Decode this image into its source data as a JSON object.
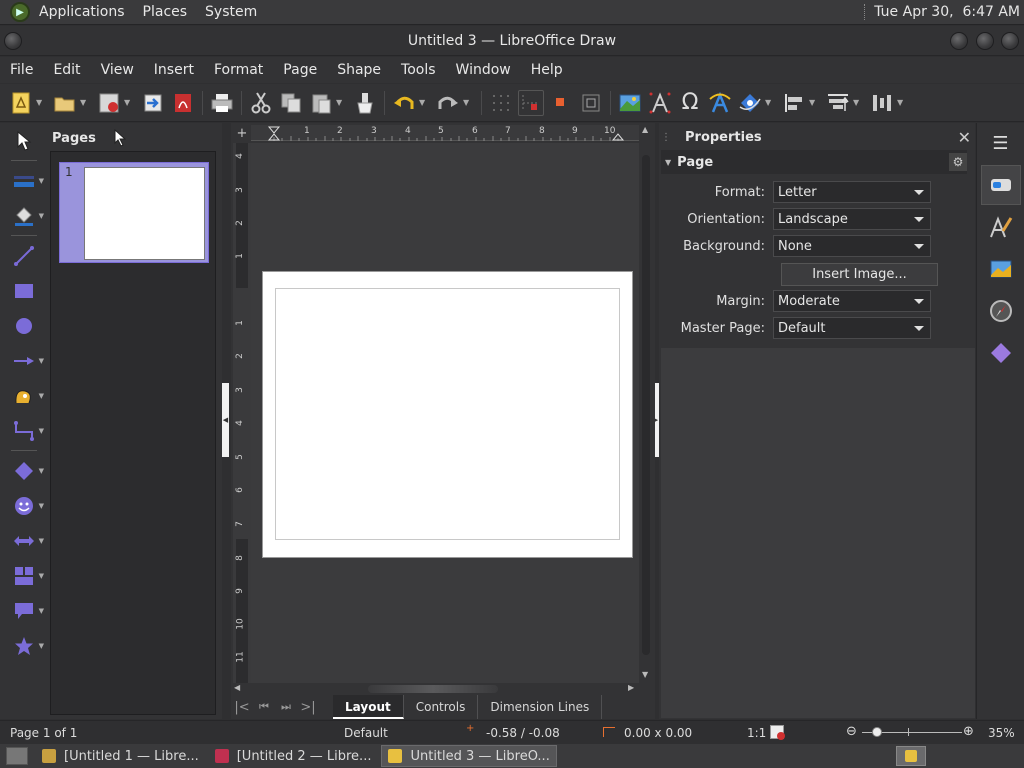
{
  "top_panel": {
    "menus": [
      "Applications",
      "Places",
      "System"
    ],
    "clock": "Tue Apr 30,  6:47 AM"
  },
  "window": {
    "title": "Untitled 3 — LibreOffice Draw"
  },
  "menubar": [
    "File",
    "Edit",
    "View",
    "Insert",
    "Format",
    "Page",
    "Shape",
    "Tools",
    "Window",
    "Help"
  ],
  "toolbar": {
    "icons": [
      "new-icon",
      "open-icon",
      "save-icon",
      "export-icon",
      "export-pdf-icon",
      "print-icon",
      "cut-icon",
      "copy-icon",
      "paste-icon",
      "clone-formatting-icon",
      "undo-icon",
      "redo-icon",
      "grid-icon",
      "helplines-icon",
      "zoom-icon",
      "image-icon",
      "fontwork-text-icon",
      "special-character-icon",
      "fontwork-icon",
      "transformations-icon",
      "align-icon",
      "arrange-icon",
      "distribute-icon"
    ]
  },
  "pages_panel": {
    "title": "Pages",
    "thumb_number": "1"
  },
  "ruler": {
    "h_ticks": [
      "1",
      "2",
      "3",
      "4",
      "5",
      "6",
      "7",
      "8",
      "9",
      "10"
    ],
    "v_ticks": [
      "4",
      "3",
      "2",
      "1",
      "1",
      "2",
      "3",
      "4",
      "5",
      "6",
      "7",
      "8",
      "9",
      "10",
      "11"
    ]
  },
  "tabs": [
    "Layout",
    "Controls",
    "Dimension Lines"
  ],
  "properties": {
    "title": "Properties",
    "section": "Page",
    "rows": [
      {
        "label": "Format:",
        "value": "Letter"
      },
      {
        "label": "Orientation:",
        "value": "Landscape"
      },
      {
        "label": "Background:",
        "value": "None"
      },
      {
        "label": "Margin:",
        "value": "Moderate"
      },
      {
        "label": "Master Page:",
        "value": "Default"
      }
    ],
    "insert_image": "Insert Image..."
  },
  "statusbar": {
    "page": "Page 1 of 1",
    "master": "Default",
    "position": "-0.58 / -0.08",
    "size": "0.00 x 0.00",
    "scale": "1:1",
    "zoom": "35%"
  },
  "taskbar": {
    "tasks": [
      "[Untitled 1 — Libre...",
      "[Untitled 2 — Libre...",
      "Untitled 3 — LibreO..."
    ]
  },
  "colors": {
    "accent": "#7b6cd8",
    "dark_bg": "#333335",
    "page": "#ffffff"
  }
}
